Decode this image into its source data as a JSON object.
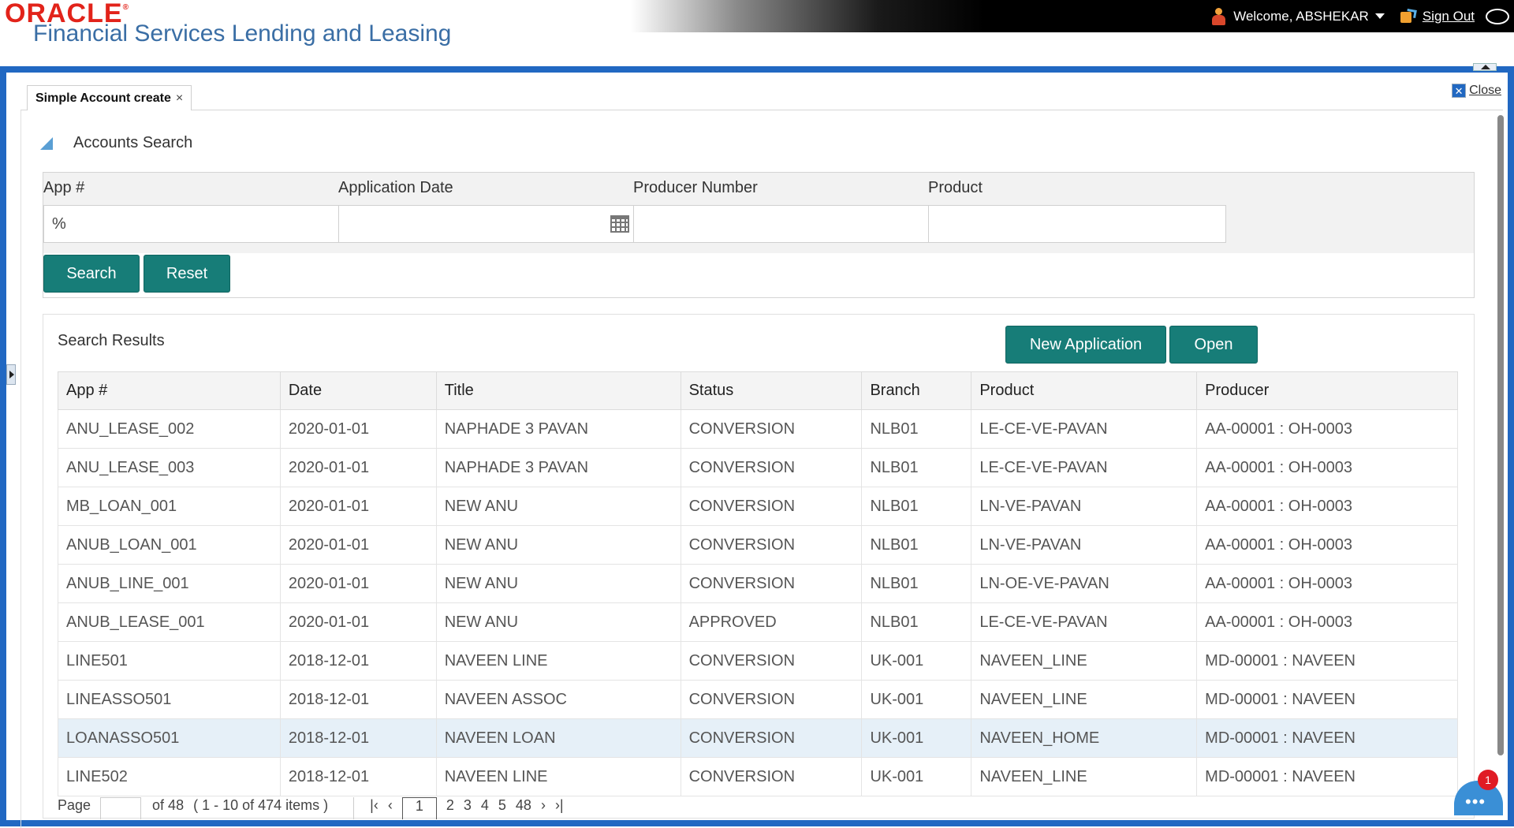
{
  "header": {
    "brand": "ORACLE",
    "product": "Financial Services Lending and Leasing",
    "welcome": "Welcome, ABSHEKAR",
    "sign_out": "Sign Out"
  },
  "tab": {
    "label": "Simple Account create",
    "close_glyph": "×"
  },
  "close_button": "Close",
  "accounts_search": {
    "title": "Accounts Search",
    "fields": {
      "app_label": "App #",
      "app_value": "%",
      "date_label": "Application Date",
      "date_value": "",
      "producer_label": "Producer Number",
      "producer_value": "",
      "product_label": "Product",
      "product_value": ""
    },
    "search_btn": "Search",
    "reset_btn": "Reset"
  },
  "results": {
    "title": "Search Results",
    "new_app_btn": "New Application",
    "open_btn": "Open",
    "columns": [
      "App #",
      "Date",
      "Title",
      "Status",
      "Branch",
      "Product",
      "Producer"
    ],
    "rows": [
      [
        "ANU_LEASE_002",
        "2020-01-01",
        "NAPHADE 3 PAVAN",
        "CONVERSION",
        "NLB01",
        "LE-CE-VE-PAVAN",
        "AA-00001 : OH-0003"
      ],
      [
        "ANU_LEASE_003",
        "2020-01-01",
        "NAPHADE 3 PAVAN",
        "CONVERSION",
        "NLB01",
        "LE-CE-VE-PAVAN",
        "AA-00001 : OH-0003"
      ],
      [
        "MB_LOAN_001",
        "2020-01-01",
        "NEW ANU",
        "CONVERSION",
        "NLB01",
        "LN-VE-PAVAN",
        "AA-00001 : OH-0003"
      ],
      [
        "ANUB_LOAN_001",
        "2020-01-01",
        "NEW ANU",
        "CONVERSION",
        "NLB01",
        "LN-VE-PAVAN",
        "AA-00001 : OH-0003"
      ],
      [
        "ANUB_LINE_001",
        "2020-01-01",
        "NEW ANU",
        "CONVERSION",
        "NLB01",
        "LN-OE-VE-PAVAN",
        "AA-00001 : OH-0003"
      ],
      [
        "ANUB_LEASE_001",
        "2020-01-01",
        "NEW ANU",
        "APPROVED",
        "NLB01",
        "LE-CE-VE-PAVAN",
        "AA-00001 : OH-0003"
      ],
      [
        "LINE501",
        "2018-12-01",
        "NAVEEN LINE",
        "CONVERSION",
        "UK-001",
        "NAVEEN_LINE",
        "MD-00001 : NAVEEN"
      ],
      [
        "LINEASSO501",
        "2018-12-01",
        "NAVEEN ASSOC",
        "CONVERSION",
        "UK-001",
        "NAVEEN_LINE",
        "MD-00001 : NAVEEN"
      ],
      [
        "LOANASSO501",
        "2018-12-01",
        "NAVEEN LOAN",
        "CONVERSION",
        "UK-001",
        "NAVEEN_HOME",
        "MD-00001 : NAVEEN"
      ],
      [
        "LINE502",
        "2018-12-01",
        "NAVEEN LINE",
        "CONVERSION",
        "UK-001",
        "NAVEEN_LINE",
        "MD-00001 : NAVEEN"
      ]
    ],
    "selected_row": 8
  },
  "pager": {
    "page_label": "Page",
    "of_pages": "of 48",
    "items": "( 1 - 10 of 474 items )",
    "current": "1",
    "pages": [
      "2",
      "3",
      "4",
      "5",
      "48"
    ]
  },
  "chat": {
    "badge": "1"
  },
  "colors": {
    "brand_red": "#e2231a",
    "brand_blue": "#3a6ea5",
    "frame_blue": "#2168c2",
    "button_teal": "#177d78",
    "selected_row": "#e6f0f8"
  },
  "icons": [
    "user-icon",
    "caret-down-icon",
    "sign-out-icon",
    "chat-icon",
    "close-icon",
    "collapse-triangle-icon",
    "calendar-icon",
    "expand-arrow-icon",
    "scroll-up-icon"
  ]
}
